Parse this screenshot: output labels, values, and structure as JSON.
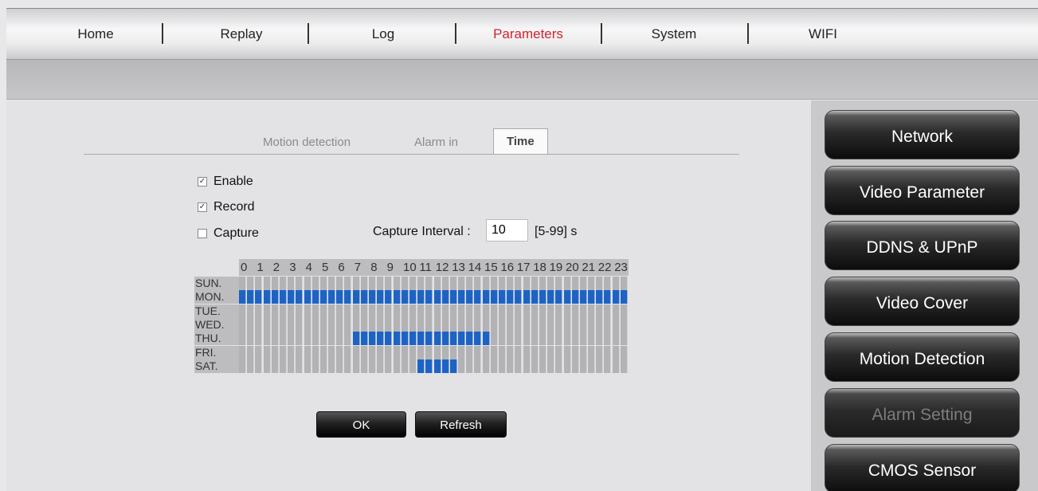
{
  "nav": {
    "items": [
      {
        "label": "Home",
        "active": false
      },
      {
        "label": "Replay",
        "active": false
      },
      {
        "label": "Log",
        "active": false
      },
      {
        "label": "Parameters",
        "active": true
      },
      {
        "label": "System",
        "active": false
      },
      {
        "label": "WIFI",
        "active": false
      }
    ]
  },
  "tabs": [
    {
      "label": "Motion detection",
      "active": false
    },
    {
      "label": "Alarm in",
      "active": false
    },
    {
      "label": "Time",
      "active": true
    }
  ],
  "form": {
    "enable": {
      "label": "Enable",
      "checked": true
    },
    "record": {
      "label": "Record",
      "checked": true
    },
    "capture": {
      "label": "Capture",
      "checked": false
    },
    "interval_label": "Capture Interval :",
    "interval_value": "10",
    "interval_hint": "[5-99] s"
  },
  "schedule": {
    "hours": [
      "0",
      "1",
      "2",
      "3",
      "4",
      "5",
      "6",
      "7",
      "8",
      "9",
      "10",
      "11",
      "12",
      "13",
      "14",
      "15",
      "16",
      "17",
      "18",
      "19",
      "20",
      "21",
      "22",
      "23"
    ],
    "days": [
      {
        "label": "SUN.",
        "on": []
      },
      {
        "label": "MON.",
        "on": [
          [
            0,
            48
          ]
        ]
      },
      {
        "label": "TUE.",
        "on": []
      },
      {
        "label": "WED.",
        "on": []
      },
      {
        "label": "THU.",
        "on": [
          [
            14,
            31
          ]
        ]
      },
      {
        "label": "FRI.",
        "on": []
      },
      {
        "label": "SAT.",
        "on": [
          [
            22,
            27
          ]
        ]
      }
    ]
  },
  "buttons": {
    "ok": "OK",
    "refresh": "Refresh"
  },
  "side_menu": [
    {
      "label": "Network",
      "disabled": false
    },
    {
      "label": "Video Parameter",
      "disabled": false
    },
    {
      "label": "DDNS & UPnP",
      "disabled": false
    },
    {
      "label": "Video Cover",
      "disabled": false
    },
    {
      "label": "Motion Detection",
      "disabled": false
    },
    {
      "label": "Alarm Setting",
      "disabled": true
    },
    {
      "label": "CMOS Sensor",
      "disabled": false
    }
  ],
  "colors": {
    "active_nav": "#d0242c",
    "schedule_on": "#1e63c4"
  }
}
